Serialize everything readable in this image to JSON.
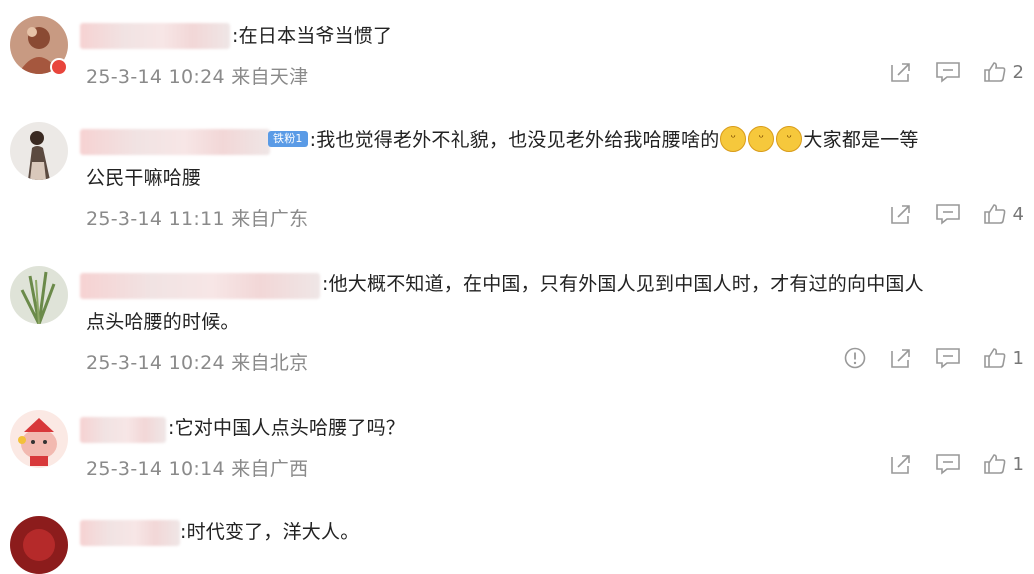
{
  "comments": [
    {
      "text": ":在日本当爷当惯了",
      "date": "25-3-14 10:24",
      "location": "来自天津",
      "likes": "2",
      "has_report": false
    },
    {
      "badge": "铁粉1",
      "text_a": ":我也觉得老外不礼貌，也没见老外给我哈腰啥的",
      "text_b": "大家都是一等",
      "text_c": "公民干嘛哈腰",
      "date": "25-3-14 11:11",
      "location": "来自广东",
      "likes": "4",
      "has_report": false
    },
    {
      "text_a": ":他大概不知道，在中国，只有外国人见到中国人时，才有过的向中国人",
      "text_b": "点头哈腰的时候。",
      "date": "25-3-14 10:24",
      "location": "来自北京",
      "likes": "1",
      "has_report": true
    },
    {
      "text": ":它对中国人点头哈腰了吗？",
      "date": "25-3-14 10:14",
      "location": "来自广西",
      "likes": "1",
      "has_report": false
    },
    {
      "text": ":时代变了，洋大人。"
    }
  ],
  "colors": {
    "meta_text": "#8a8a8a",
    "icon": "#999999",
    "badge_blue": "#5a9be6",
    "avatar_badge_red": "#e8453c"
  },
  "icons": [
    "share-icon",
    "comment-icon",
    "like-icon",
    "report-icon"
  ]
}
